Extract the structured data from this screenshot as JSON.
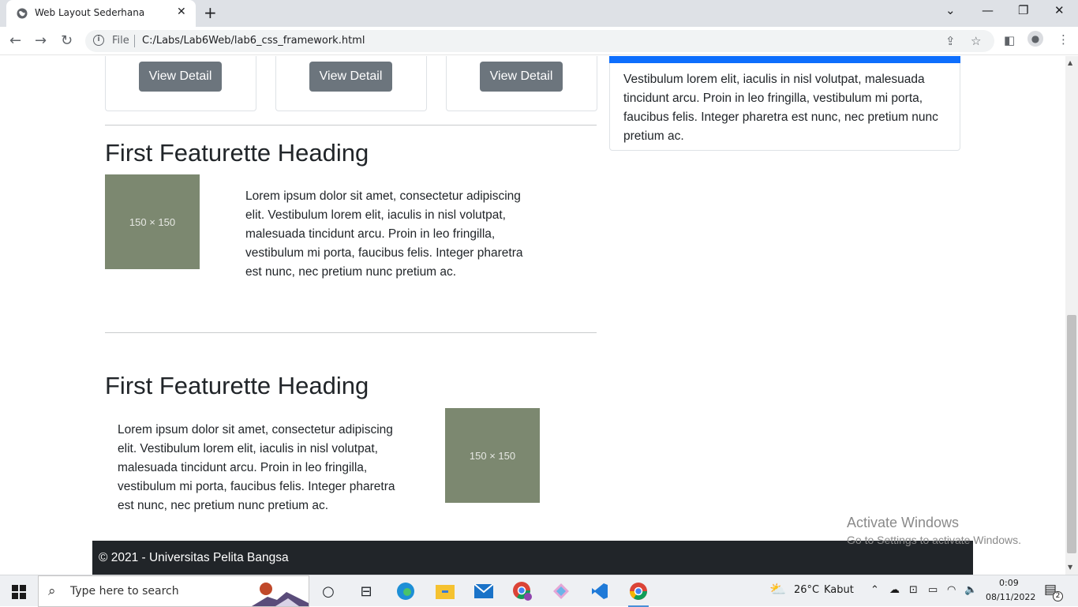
{
  "browser": {
    "tab_title": "Web Layout Sederhana",
    "address_scheme": "File",
    "address_url": "C:/Labs/Lab6Web/lab6_css_framework.html"
  },
  "cards": [
    {
      "button_label": "View Detail"
    },
    {
      "button_label": "View Detail"
    },
    {
      "button_label": "View Detail"
    }
  ],
  "sidebar": {
    "text": "Vestibulum lorem elit, iaculis in nisl volutpat, malesuada tincidunt arcu. Proin in leo fringilla, vestibulum mi porta, faucibus felis. Integer pharetra est nunc, nec pretium nunc pretium ac.",
    "accent_color": "#0d6efd"
  },
  "featurettes": [
    {
      "heading": "First Featurette Heading",
      "image_label": "150 × 150",
      "text": "Lorem ipsum dolor sit amet, consectetur adipiscing elit. Vestibulum lorem elit, iaculis in nisl volutpat, malesuada tincidunt arcu. Proin in leo fringilla, vestibulum mi porta, faucibus felis. Integer pharetra est nunc, nec pretium nunc pretium ac."
    },
    {
      "heading": "First Featurette Heading",
      "image_label": "150 × 150",
      "text": "Lorem ipsum dolor sit amet, consectetur adipiscing elit. Vestibulum lorem elit, iaculis in nisl volutpat, malesuada tincidunt arcu. Proin in leo fringilla, vestibulum mi porta, faucibus felis. Integer pharetra est nunc, nec pretium nunc pretium ac."
    }
  ],
  "footer": {
    "text": "© 2021 - Universitas Pelita Bangsa"
  },
  "watermark": {
    "line1": "Activate Windows",
    "line2": "Go to Settings to activate Windows."
  },
  "taskbar": {
    "search_placeholder": "Type here to search",
    "weather_temp": "26°C",
    "weather_text": "Kabut",
    "time": "0:09",
    "date": "08/11/2022",
    "notification_count": "2"
  }
}
